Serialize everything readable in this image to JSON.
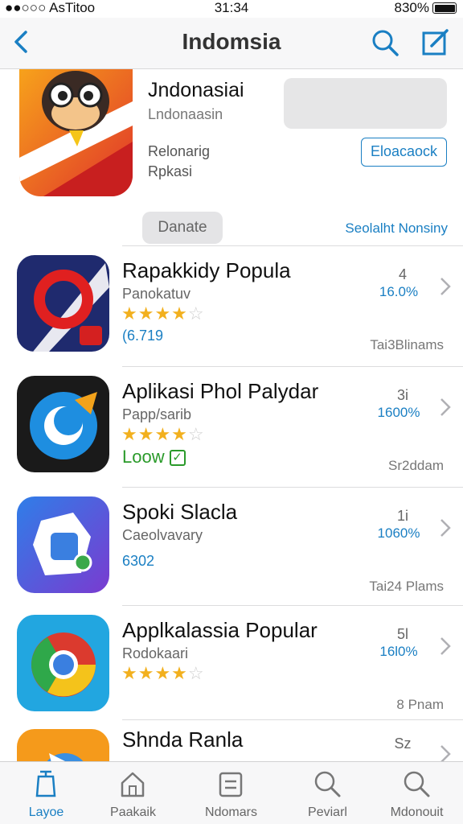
{
  "status_bar": {
    "carrier": "●●○○○ AsTitoo",
    "time": "31:34",
    "battery": "830%"
  },
  "nav": {
    "title": "Indomsia"
  },
  "featured": {
    "name": "Jndonasiai",
    "subtitle": "Lndonaasin",
    "meta_line1": "Relonarig",
    "meta_line2": "Rpkasi",
    "button_label": "Eloacaock"
  },
  "segment": {
    "pill_label": "Danate",
    "link_label": "Seolalht Nonsiny"
  },
  "apps": [
    {
      "name": "Rapakkidy Popula",
      "category": "Panokatuv",
      "rating_filled": 4,
      "rating_total": 5,
      "extra": "(6.719",
      "extra_style": "blue",
      "rank": "4",
      "percent": "16.0%",
      "size": "Tai3Blinams"
    },
    {
      "name": "Aplikasi Phol Palydar",
      "category": "Papp/sarib",
      "rating_filled": 4,
      "rating_total": 5,
      "extra": "Loow",
      "extra_style": "green",
      "rank": "3i",
      "percent": "1600%",
      "size": "Sr2ddam"
    },
    {
      "name": "Spoki Slacla",
      "category": "Caeolvavary",
      "rating_filled": 0,
      "rating_total": 0,
      "extra": "6302",
      "extra_style": "blue",
      "rank": "1i",
      "percent": "1060%",
      "size": "Tai24 Plams"
    },
    {
      "name": "Applkalassia Popular",
      "category": "Rodokaari",
      "rating_filled": 4,
      "rating_total": 5,
      "extra": "",
      "extra_style": "blue",
      "rank": "5l",
      "percent": "16l0%",
      "size": "8 Pnam"
    },
    {
      "name": "Shnda Ranla",
      "category": "",
      "rating_filled": 0,
      "rating_total": 0,
      "extra": "",
      "extra_style": "blue",
      "rank": "Sz",
      "percent": "",
      "size": ""
    }
  ],
  "tabs": [
    {
      "label": "Layoe",
      "icon": "box-icon",
      "active": true
    },
    {
      "label": "Paakaik",
      "icon": "house-icon",
      "active": false
    },
    {
      "label": "Ndomars",
      "icon": "list-icon",
      "active": false
    },
    {
      "label": "Peviarl",
      "icon": "search-icon",
      "active": false
    },
    {
      "label": "Mdonouit",
      "icon": "search-icon",
      "active": false
    }
  ],
  "colors": {
    "accent": "#1a7fc3",
    "star": "#f2b01e",
    "green": "#2a9a2a"
  }
}
